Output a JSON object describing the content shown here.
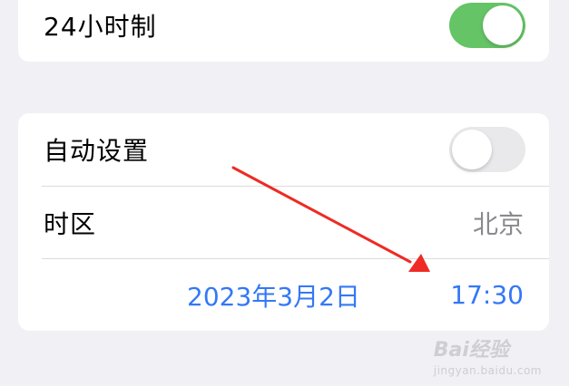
{
  "settings": {
    "clock_24h": {
      "label": "24小时制",
      "enabled": true
    },
    "auto_set": {
      "label": "自动设置",
      "enabled": false
    },
    "timezone": {
      "label": "时区",
      "value": "北京"
    },
    "datetime": {
      "date": "2023年3月2日",
      "time": "17:30"
    }
  },
  "annotation": {
    "arrow_color": "#ee2b24"
  },
  "watermark": {
    "logo": "Bai经验",
    "url": "jingyan.baidu.com"
  },
  "colors": {
    "background": "#f0f0f5",
    "card": "#ffffff",
    "toggle_on": "#65c466",
    "toggle_off": "#e9e9eb",
    "link_blue": "#3478f6",
    "secondary_text": "#8a8a8e"
  }
}
